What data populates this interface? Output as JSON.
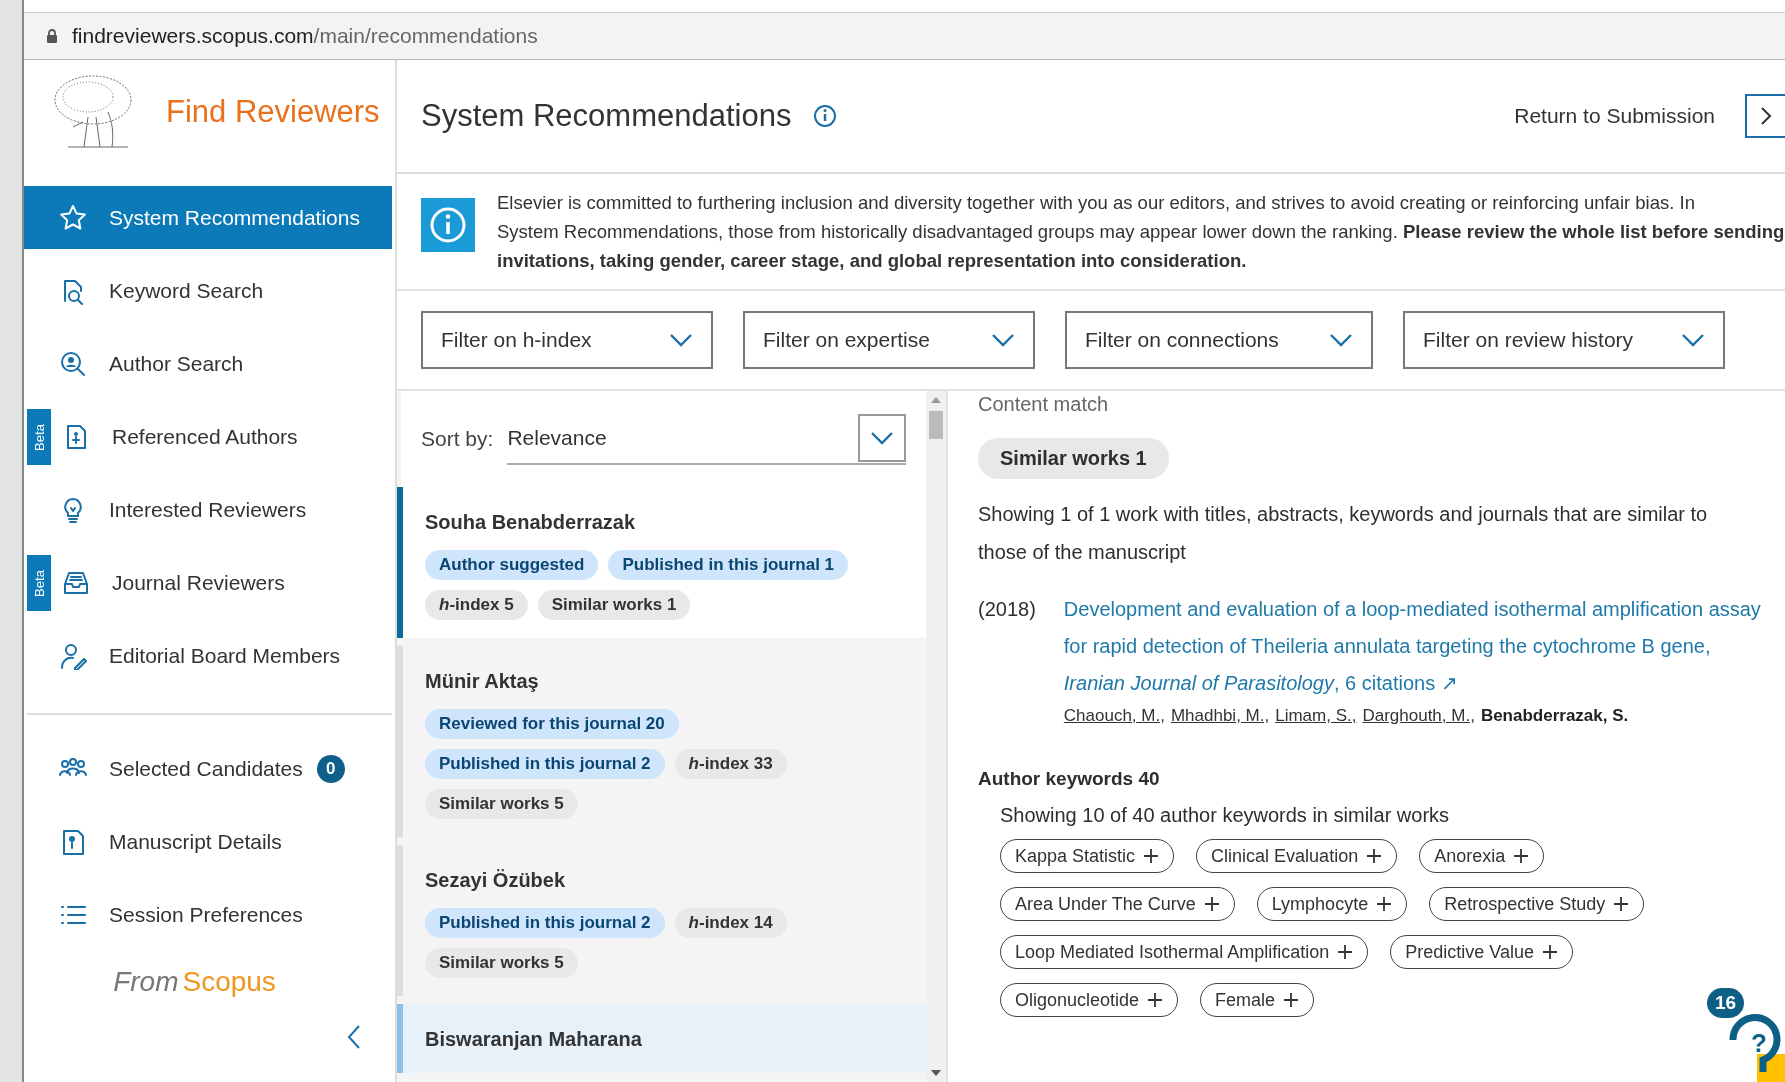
{
  "address_bar": {
    "host": "findreviewers.scopus.com",
    "path": "/main/recommendations"
  },
  "app": {
    "title": "Find Reviewers",
    "footer_from": "From",
    "footer_brand": "Scopus"
  },
  "sidebar": {
    "items": [
      {
        "label": "System Recommendations",
        "selected": true,
        "beta": false
      },
      {
        "label": "Keyword Search",
        "selected": false,
        "beta": false
      },
      {
        "label": "Author Search",
        "selected": false,
        "beta": false
      },
      {
        "label": "Referenced Authors",
        "selected": false,
        "beta": "Beta"
      },
      {
        "label": "Interested Reviewers",
        "selected": false,
        "beta": false
      },
      {
        "label": "Journal Reviewers",
        "selected": false,
        "beta": "Beta"
      },
      {
        "label": "Editorial Board Members",
        "selected": false,
        "beta": false
      }
    ],
    "secondary_items": [
      {
        "label": "Selected Candidates",
        "badge": "0"
      },
      {
        "label": "Manuscript Details"
      },
      {
        "label": "Session Preferences"
      }
    ]
  },
  "header": {
    "title": "System Recommendations",
    "return_link": "Return to Submission"
  },
  "banner": {
    "text": "Elsevier is committed to furthering inclusion and diversity together with you as our editors, and strives to avoid creating or reinforcing unfair bias. In\nSystem Recommendations, those from historically disadvantaged groups may appear lower down the ranking. **Please review the whole list before sending\ninvitations, taking gender, career stage, and global representation into consideration.**"
  },
  "filters": [
    "Filter on h-index",
    "Filter on expertise",
    "Filter on connections",
    "Filter on review history"
  ],
  "sort": {
    "label": "Sort by:",
    "value": "Relevance"
  },
  "candidates": [
    {
      "name": "Souha Benabderrazak",
      "selected": true,
      "hovered": false,
      "tags": [
        {
          "label": "Author suggested",
          "kind": "highlight"
        },
        {
          "label": "Published in this journal 1",
          "kind": "highlight"
        },
        {
          "label": "*h*-index 5",
          "kind": "plain"
        },
        {
          "label": "Similar works 1",
          "kind": "plain"
        }
      ]
    },
    {
      "name": "Münir Aktaş",
      "selected": false,
      "hovered": false,
      "tags": [
        {
          "label": "Reviewed for this journal 20",
          "kind": "highlight"
        },
        {
          "label": "Published in this journal 2",
          "kind": "highlight"
        },
        {
          "label": "*h*-index 33",
          "kind": "plain"
        },
        {
          "label": "Similar works 5",
          "kind": "plain"
        }
      ]
    },
    {
      "name": "Sezayi Özübek",
      "selected": false,
      "hovered": false,
      "tags": [
        {
          "label": "Published in this journal 2",
          "kind": "highlight"
        },
        {
          "label": "*h*-index 14",
          "kind": "plain"
        },
        {
          "label": "Similar works 5",
          "kind": "plain"
        }
      ]
    },
    {
      "name": "Biswaranjan Maharana",
      "selected": false,
      "hovered": true
    }
  ],
  "detail": {
    "section_label": "Content match",
    "chip": "Similar works 1",
    "description": "Showing 1 of 1 work with titles, abstracts, keywords and journals that are similar to those of the manuscript",
    "work": {
      "year": "(2018)",
      "title": "Development and evaluation of a loop-mediated isothermal amplification assay for rapid detection of Theileria annulata targeting the cytochrome B gene, *Iranian Journal of Parasitology*, 6 citations ↗",
      "authors": [
        {
          "name": "Chaouch, M.,",
          "linked": true
        },
        {
          "name": "Mhadhbi, M.,",
          "linked": true
        },
        {
          "name": "Limam, S.,",
          "linked": true
        },
        {
          "name": "Darghouth, M.,",
          "linked": true
        },
        {
          "name": "Benabderrazak, S.",
          "linked": false
        }
      ]
    },
    "keywords_heading": "Author keywords 40",
    "keywords_note": "Showing 10 of 40 author keywords in similar works",
    "keywords": [
      "Kappa Statistic",
      "Clinical Evaluation",
      "Anorexia",
      "Area Under The Curve",
      "Lymphocyte",
      "Retrospective Study",
      "Loop Mediated Isothermal Amplification",
      "Predictive Value",
      "Oligonucleotide",
      "Female"
    ]
  },
  "help": {
    "count": "16",
    "symbol": "?"
  }
}
